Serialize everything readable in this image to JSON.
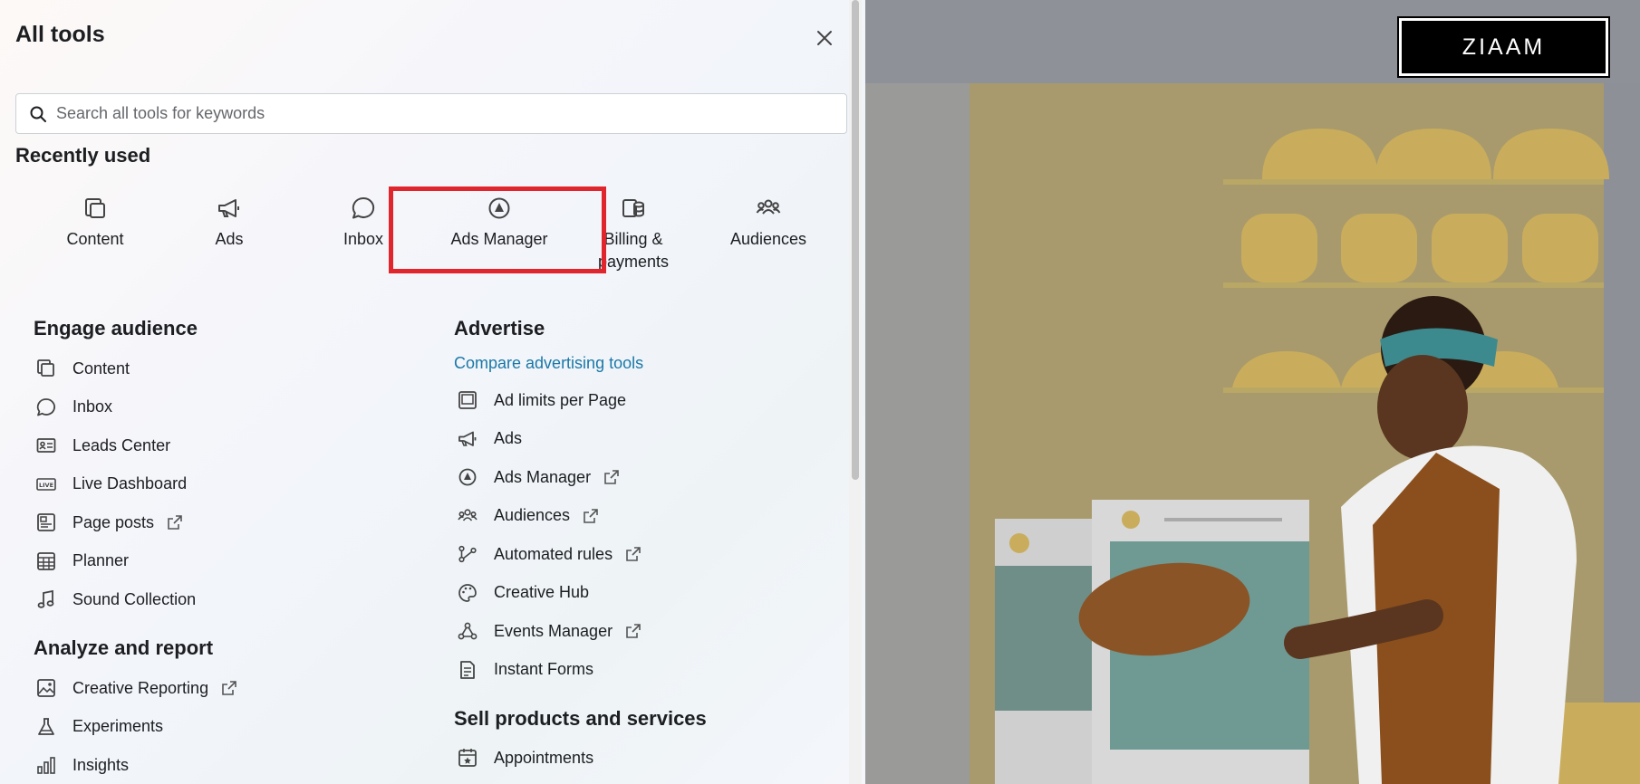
{
  "panel": {
    "title": "All tools",
    "search_placeholder": "Search all tools for keywords"
  },
  "recently_used": {
    "heading": "Recently used",
    "items": [
      {
        "label": "Content",
        "icon": "content-icon"
      },
      {
        "label": "Ads",
        "icon": "megaphone-icon"
      },
      {
        "label": "Inbox",
        "icon": "chat-bubble-icon"
      },
      {
        "label": "Ads Manager",
        "icon": "ads-manager-icon"
      },
      {
        "label": "Billing & payments",
        "icon": "billing-icon"
      },
      {
        "label": "Audiences",
        "icon": "audiences-icon"
      }
    ]
  },
  "engage": {
    "heading": "Engage audience",
    "items": [
      {
        "label": "Content",
        "icon": "content-icon",
        "external": false
      },
      {
        "label": "Inbox",
        "icon": "chat-bubble-icon",
        "external": false
      },
      {
        "label": "Leads Center",
        "icon": "id-card-icon",
        "external": false
      },
      {
        "label": "Live Dashboard",
        "icon": "live-icon",
        "external": false
      },
      {
        "label": "Page posts",
        "icon": "page-posts-icon",
        "external": true
      },
      {
        "label": "Planner",
        "icon": "calendar-icon",
        "external": false
      },
      {
        "label": "Sound Collection",
        "icon": "music-note-icon",
        "external": false
      }
    ]
  },
  "analyze": {
    "heading": "Analyze and report",
    "items": [
      {
        "label": "Creative Reporting",
        "icon": "image-icon",
        "external": true
      },
      {
        "label": "Experiments",
        "icon": "flask-icon",
        "external": false
      },
      {
        "label": "Insights",
        "icon": "bar-chart-icon",
        "external": false
      }
    ]
  },
  "advertise": {
    "heading": "Advertise",
    "compare_link": "Compare advertising tools",
    "items": [
      {
        "label": "Ad limits per Page",
        "icon": "ad-limits-icon",
        "external": false
      },
      {
        "label": "Ads",
        "icon": "megaphone-icon",
        "external": false
      },
      {
        "label": "Ads Manager",
        "icon": "ads-manager-icon",
        "external": true
      },
      {
        "label": "Audiences",
        "icon": "audiences-icon",
        "external": true
      },
      {
        "label": "Automated rules",
        "icon": "automated-rules-icon",
        "external": true
      },
      {
        "label": "Creative Hub",
        "icon": "palette-icon",
        "external": false
      },
      {
        "label": "Events Manager",
        "icon": "events-icon",
        "external": true
      },
      {
        "label": "Instant Forms",
        "icon": "form-icon",
        "external": false
      }
    ]
  },
  "sell": {
    "heading": "Sell products and services",
    "items": [
      {
        "label": "Appointments",
        "icon": "appointments-icon",
        "external": false
      }
    ]
  },
  "brand": {
    "logo_text": "ZIAAM"
  }
}
